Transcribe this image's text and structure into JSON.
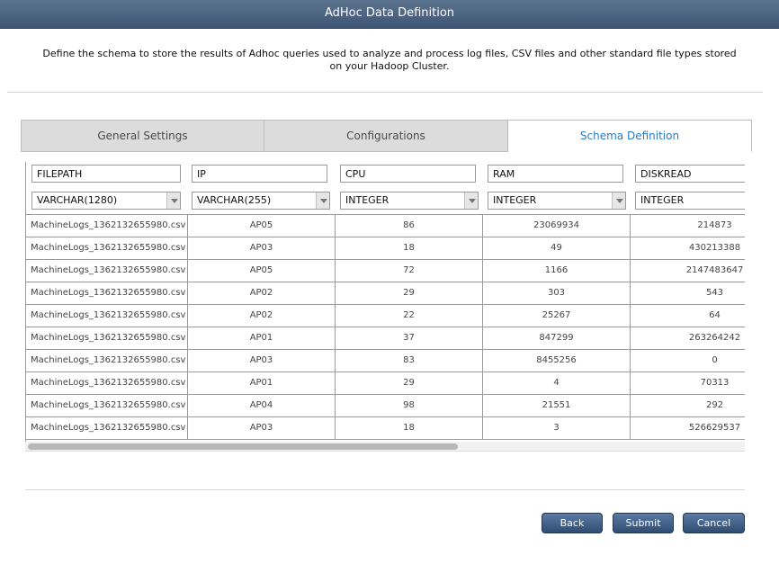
{
  "window": {
    "title": "AdHoc Data Definition"
  },
  "description": "Define the schema to store the results of Adhoc queries used to analyze and process log files, CSV files and other standard file types stored on your Hadoop Cluster.",
  "tabs": [
    {
      "label": "General Settings",
      "active": false
    },
    {
      "label": "Configurations",
      "active": false
    },
    {
      "label": "Schema Definition",
      "active": true
    }
  ],
  "columns": [
    {
      "name": "FILEPATH",
      "type": "VARCHAR(1280)"
    },
    {
      "name": "IP",
      "type": "VARCHAR(255)"
    },
    {
      "name": "CPU",
      "type": "INTEGER"
    },
    {
      "name": "RAM",
      "type": "INTEGER"
    },
    {
      "name": "DISKREAD",
      "type": "INTEGER"
    }
  ],
  "rows": [
    [
      "MachineLogs_1362132655980.csv",
      "AP05",
      "86",
      "23069934",
      "214873"
    ],
    [
      "MachineLogs_1362132655980.csv",
      "AP03",
      "18",
      "49",
      "430213388"
    ],
    [
      "MachineLogs_1362132655980.csv",
      "AP05",
      "72",
      "1166",
      "2147483647"
    ],
    [
      "MachineLogs_1362132655980.csv",
      "AP02",
      "29",
      "303",
      "543"
    ],
    [
      "MachineLogs_1362132655980.csv",
      "AP02",
      "22",
      "25267",
      "64"
    ],
    [
      "MachineLogs_1362132655980.csv",
      "AP01",
      "37",
      "847299",
      "263264242"
    ],
    [
      "MachineLogs_1362132655980.csv",
      "AP03",
      "83",
      "8455256",
      "0"
    ],
    [
      "MachineLogs_1362132655980.csv",
      "AP01",
      "29",
      "4",
      "70313"
    ],
    [
      "MachineLogs_1362132655980.csv",
      "AP04",
      "98",
      "21551",
      "292"
    ],
    [
      "MachineLogs_1362132655980.csv",
      "AP03",
      "18",
      "3",
      "526629537"
    ]
  ],
  "buttons": {
    "back": "Back",
    "submit": "Submit",
    "cancel": "Cancel"
  },
  "colors": {
    "accent": "#2c7bc4",
    "titlebar": "#4a6282",
    "button": "#3e5b82"
  }
}
